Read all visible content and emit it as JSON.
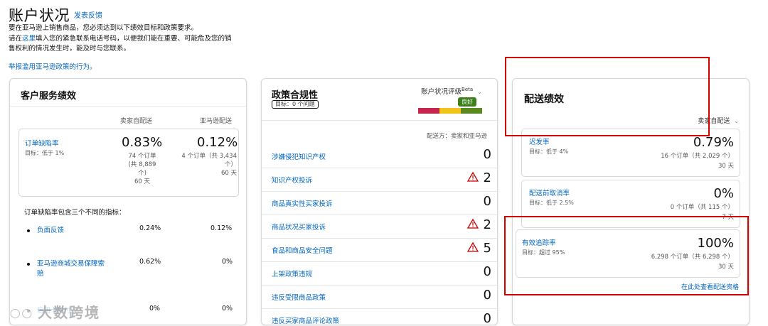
{
  "header": {
    "title": "账户状况",
    "feedback_link": "发表反馈",
    "intro_line1": "要在亚马逊上销售商品，您必须达到以下绩效目标和政策要求。",
    "intro_line2_a": "请在",
    "intro_line2_link": "这里",
    "intro_line2_b": "填入您的紧急联系电话号码，以便我们能在重要、可能危及您的销",
    "intro_line3": "售权利的情况发生时，能及时与您联系。",
    "report_link": "举报滥用亚马逊政策的行为。"
  },
  "customer_service": {
    "title": "客户服务绩效",
    "col_seller": "卖家自配送",
    "col_amazon": "亚马逊配送",
    "odr": {
      "name": "订单缺陷率",
      "target": "目标：低于 1%",
      "seller_pct": "0.83%",
      "seller_line1": "74 个订单",
      "seller_line2": "(共 8,889",
      "seller_line3": "个)",
      "seller_days": "60 天",
      "amazon_pct": "0.12%",
      "amazon_line1": "4 个订单（共 3,434",
      "amazon_line2": "个）",
      "amazon_days": "60 天"
    },
    "breakdown_title": "订单缺陷率包含三个不同的指标：",
    "rows": [
      {
        "label": "负面反馈",
        "seller": "0.24%",
        "amazon": "0.12%"
      },
      {
        "label_line1": "亚马逊商城交易保障索",
        "label_line2": "赔",
        "seller": "0.62%",
        "amazon": "0%"
      },
      {
        "label": "信用卡拒付",
        "seller": "0%",
        "amazon": "0%"
      }
    ]
  },
  "policy": {
    "title": "政策合规性",
    "target": "目标：0 个问题",
    "rating_label": "账户状况评级",
    "beta": "Beta",
    "rating_value": "良好",
    "fulfillment_note": "配送方：卖家和亚马逊",
    "rows": [
      {
        "label": "涉嫌侵犯知识产权",
        "count": "0",
        "warn": false
      },
      {
        "label": "知识产权投诉",
        "count": "2",
        "warn": true
      },
      {
        "label": "商品真实性买家投诉",
        "count": "0",
        "warn": false
      },
      {
        "label": "商品状况买家投诉",
        "count": "2",
        "warn": true
      },
      {
        "label": "食品和商品安全问题",
        "count": "5",
        "warn": true
      },
      {
        "label": "上架政策违规",
        "count": "0",
        "warn": false
      },
      {
        "label": "违反受限商品政策",
        "count": "0",
        "warn": false
      },
      {
        "label": "违反买家商品评论政策",
        "count": "0",
        "warn": false
      }
    ],
    "colors": {
      "red": "#c7254e",
      "yellow": "#f0c419",
      "green": "#5a8a1f"
    }
  },
  "shipping": {
    "title": "配送绩效",
    "filter": "卖家自配送",
    "late": {
      "name": "迟发率",
      "target": "目标：低于 4%",
      "value": "0.79%",
      "detail": "16 个订单（共 2,029 个）",
      "days": "30 天"
    },
    "cancel": {
      "name": "配送前取消率",
      "target": "目标：低于 2.5%",
      "value": "0%",
      "detail": "0 个订单（共 115 个）",
      "days": "7 天"
    },
    "tracking": {
      "name": "有效追踪率",
      "target": "目标：超过 95%",
      "value": "100%",
      "detail": "6,298 个订单（共 6,298 个）",
      "days": "30 天"
    },
    "view_link": "在此处查看配送资格"
  },
  "watermark": "大数跨境"
}
